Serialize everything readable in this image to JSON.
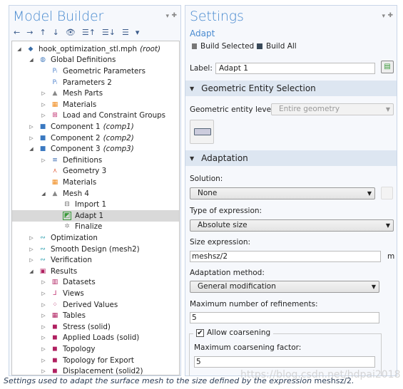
{
  "left": {
    "title": "Model Builder",
    "toolbar": [
      "←",
      "→",
      "↑",
      "↓",
      "👁",
      "☰↑",
      "☰↓",
      "☰",
      "▾"
    ],
    "tree": [
      {
        "label": "hook_optimization_stl.mph",
        "suffix": "(root)",
        "level": 0,
        "arrow": "open",
        "icon": "model-icon",
        "color": "#3a6ea8"
      },
      {
        "label": "Global Definitions",
        "level": 1,
        "arrow": "open",
        "icon": "globe-icon",
        "color": "#4a7fbf"
      },
      {
        "label": "Geometric Parameters",
        "level": 2,
        "arrow": "none",
        "icon": "parameters-icon",
        "color": "#5a8ad0"
      },
      {
        "label": "Parameters 2",
        "level": 2,
        "arrow": "none",
        "icon": "parameters-icon",
        "color": "#5a8ad0"
      },
      {
        "label": "Mesh Parts",
        "level": 2,
        "arrow": "closed",
        "icon": "mesh-icon",
        "color": "#888"
      },
      {
        "label": "Materials",
        "level": 2,
        "arrow": "closed",
        "icon": "materials-icon",
        "color": "#f08a1c"
      },
      {
        "label": "Load and Constraint Groups",
        "level": 2,
        "arrow": "closed",
        "icon": "load-groups-icon",
        "color": "#c03070"
      },
      {
        "label": "Component 1",
        "suffix": "(comp1)",
        "level": 1,
        "arrow": "closed",
        "icon": "component-icon",
        "color": "#3a78c0"
      },
      {
        "label": "Component 2",
        "suffix": "(comp2)",
        "level": 1,
        "arrow": "closed",
        "icon": "component-icon",
        "color": "#3a78c0"
      },
      {
        "label": "Component 3",
        "suffix": "(comp3)",
        "level": 1,
        "arrow": "open",
        "icon": "component-icon",
        "color": "#3a78c0"
      },
      {
        "label": "Definitions",
        "level": 2,
        "arrow": "closed",
        "icon": "definitions-icon",
        "color": "#3a6ab0"
      },
      {
        "label": "Geometry 3",
        "level": 2,
        "arrow": "none",
        "icon": "geometry-icon",
        "color": "#e06040"
      },
      {
        "label": "Materials",
        "level": 2,
        "arrow": "none",
        "icon": "materials-icon",
        "color": "#f08a1c"
      },
      {
        "label": "Mesh 4",
        "level": 2,
        "arrow": "open",
        "icon": "mesh-icon",
        "color": "#888"
      },
      {
        "label": "Import 1",
        "level": 3,
        "arrow": "none",
        "icon": "import-icon",
        "color": "#666"
      },
      {
        "label": "Adapt 1",
        "level": 3,
        "arrow": "none",
        "icon": "adapt-icon",
        "color": "#3a9a3a",
        "selected": true
      },
      {
        "label": "Finalize",
        "level": 3,
        "arrow": "none",
        "icon": "finalize-icon",
        "color": "#999"
      },
      {
        "label": "Optimization",
        "level": 1,
        "arrow": "closed",
        "icon": "optimization-icon",
        "color": "#30a0b0"
      },
      {
        "label": "Smooth Design (mesh2)",
        "level": 1,
        "arrow": "closed",
        "icon": "optimization-icon",
        "color": "#30a0b0"
      },
      {
        "label": "Verification",
        "level": 1,
        "arrow": "closed",
        "icon": "optimization-icon",
        "color": "#30a0b0"
      },
      {
        "label": "Results",
        "level": 1,
        "arrow": "open",
        "icon": "results-icon",
        "color": "#b02060"
      },
      {
        "label": "Datasets",
        "level": 2,
        "arrow": "closed",
        "icon": "datasets-icon",
        "color": "#b02060"
      },
      {
        "label": "Views",
        "level": 2,
        "arrow": "closed",
        "icon": "views-icon",
        "color": "#c03070"
      },
      {
        "label": "Derived Values",
        "level": 2,
        "arrow": "closed",
        "icon": "derived-values-icon",
        "color": "#b02060"
      },
      {
        "label": "Tables",
        "level": 2,
        "arrow": "closed",
        "icon": "tables-icon",
        "color": "#b02060"
      },
      {
        "label": "Stress (solid)",
        "level": 2,
        "arrow": "closed",
        "icon": "plot-group-icon",
        "color": "#b02060"
      },
      {
        "label": "Applied Loads (solid)",
        "level": 2,
        "arrow": "closed",
        "icon": "plot-group-icon",
        "color": "#b02060"
      },
      {
        "label": "Topology",
        "level": 2,
        "arrow": "closed",
        "icon": "plot-group-icon",
        "color": "#b02060"
      },
      {
        "label": "Topology for Export",
        "level": 2,
        "arrow": "closed",
        "icon": "plot-group-icon",
        "color": "#b02060"
      },
      {
        "label": "Displacement (solid2)",
        "level": 2,
        "arrow": "closed",
        "icon": "plot-group-icon",
        "color": "#b02060"
      }
    ]
  },
  "right": {
    "title": "Settings",
    "subtitle": "Adapt",
    "build_selected": "Build Selected",
    "build_all": "Build All",
    "label_caption": "Label:",
    "label_value": "Adapt 1",
    "sec_geom": "Geometric Entity Selection",
    "geom_level_caption": "Geometric entity level:",
    "geom_level_value": "Entire geometry",
    "sec_adapt": "Adaptation",
    "solution_caption": "Solution:",
    "solution_value": "None",
    "type_caption": "Type of expression:",
    "type_value": "Absolute size",
    "size_caption": "Size expression:",
    "size_value": "meshsz/2",
    "size_unit": "m",
    "method_caption": "Adaptation method:",
    "method_value": "General modification",
    "refine_caption": "Maximum number of refinements:",
    "refine_value": "5",
    "coarsen_label": "Allow coarsening",
    "coarsen_checked": true,
    "coarsen_factor_caption": "Maximum coarsening factor:",
    "coarsen_factor_value": "5"
  },
  "caption": {
    "a": "Settings used to adapt the surface mesh to the size defined by the expression ",
    "b": "meshsz/2",
    "c": "."
  },
  "watermark": "https://blog.csdn.net/hdpai2018",
  "colors": {
    "accent": "#4a8bd0",
    "section": "#dde6f1",
    "selected": "#d9d9d9"
  }
}
